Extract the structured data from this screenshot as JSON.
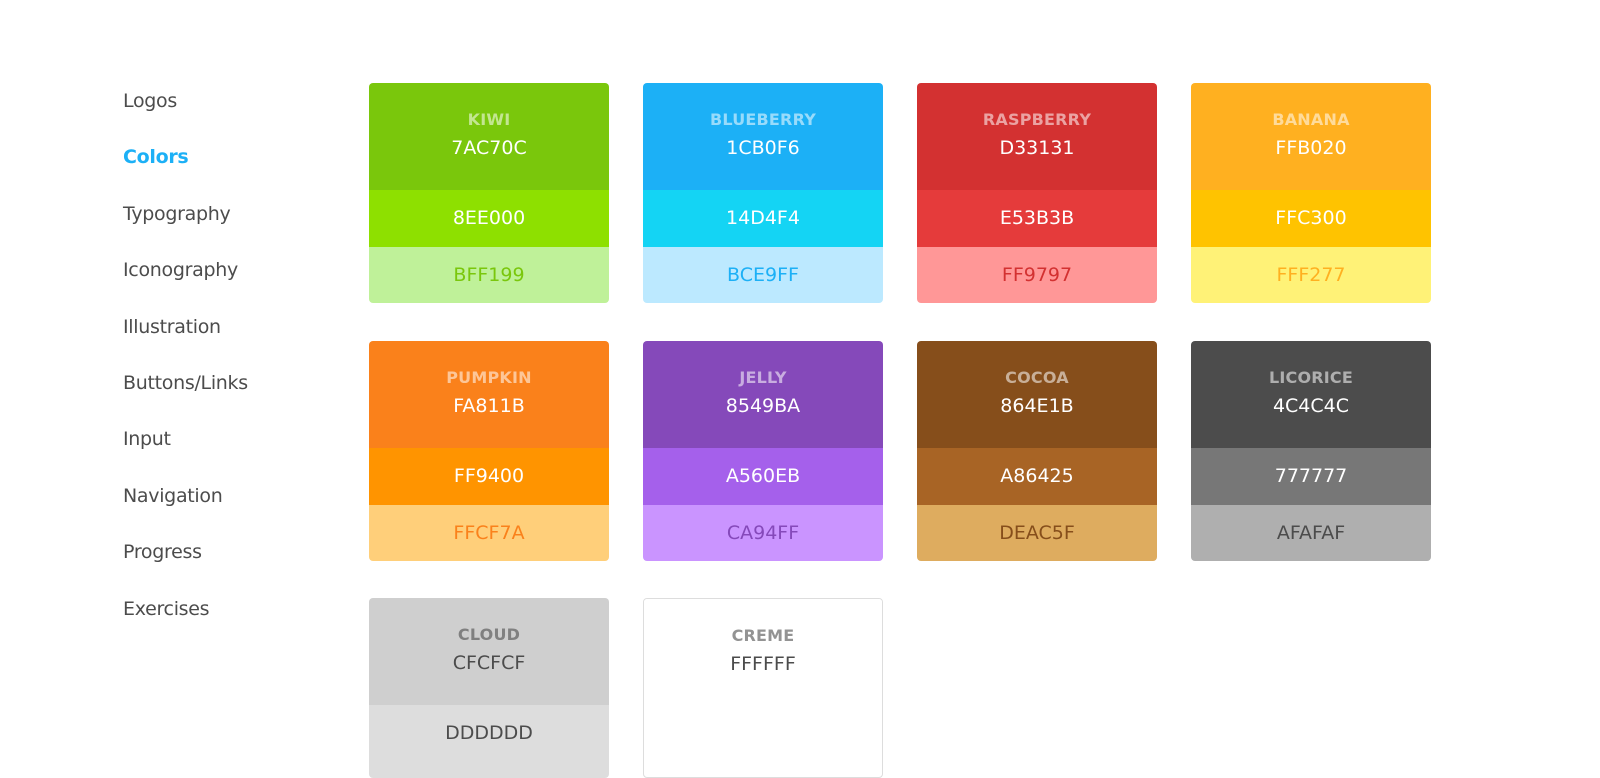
{
  "sidebar": {
    "items": [
      {
        "label": "Logos",
        "active": false
      },
      {
        "label": "Colors",
        "active": true
      },
      {
        "label": "Typography",
        "active": false
      },
      {
        "label": "Iconography",
        "active": false
      },
      {
        "label": "Illustration",
        "active": false
      },
      {
        "label": "Buttons/Links",
        "active": false
      },
      {
        "label": "Input",
        "active": false
      },
      {
        "label": "Navigation",
        "active": false
      },
      {
        "label": "Progress",
        "active": false
      },
      {
        "label": "Exercises",
        "active": false
      }
    ]
  },
  "colors": [
    {
      "name": "KIWI",
      "primary": "7AC70C",
      "secondary": "8EE000",
      "tertiary": "BFF199",
      "text_primary": "#ffffff",
      "text_tertiary": "#7ac70c"
    },
    {
      "name": "BLUEBERRY",
      "primary": "1CB0F6",
      "secondary": "14D4F4",
      "tertiary": "BCE9FF",
      "text_primary": "#ffffff",
      "text_tertiary": "#1cb0f6"
    },
    {
      "name": "RASPBERRY",
      "primary": "D33131",
      "secondary": "E53B3B",
      "tertiary": "FF9797",
      "text_primary": "#ffffff",
      "text_tertiary": "#d33131"
    },
    {
      "name": "BANANA",
      "primary": "FFB020",
      "secondary": "FFC300",
      "tertiary": "FFF277",
      "text_primary": "#ffffff",
      "text_tertiary": "#ffb020"
    },
    {
      "name": "PUMPKIN",
      "primary": "FA811B",
      "secondary": "FF9400",
      "tertiary": "FFCF7A",
      "text_primary": "#ffffff",
      "text_tertiary": "#fa811b"
    },
    {
      "name": "JELLY",
      "primary": "8549BA",
      "secondary": "A560EB",
      "tertiary": "CA94FF",
      "text_primary": "#ffffff",
      "text_tertiary": "#8549ba"
    },
    {
      "name": "COCOA",
      "primary": "864E1B",
      "secondary": "A86425",
      "tertiary": "DEAC5F",
      "text_primary": "#ffffff",
      "text_tertiary": "#864e1b"
    },
    {
      "name": "LICORICE",
      "primary": "4C4C4C",
      "secondary": "777777",
      "tertiary": "AFAFAF",
      "text_primary": "#ffffff",
      "text_tertiary": "#4c4c4c"
    },
    {
      "name": "CLOUD",
      "primary": "CFCFCF",
      "secondary": "DDDDDD",
      "text_primary": "#4c4c4c"
    },
    {
      "name": "CREME",
      "primary": "FFFFFF",
      "text_primary": "#4c4c4c"
    }
  ]
}
